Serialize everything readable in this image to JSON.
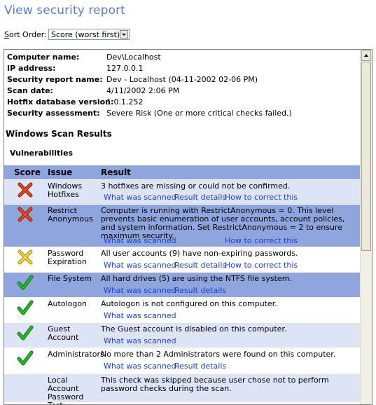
{
  "page": {
    "title": "View security report",
    "sort_label_access": "S",
    "sort_label_rest": "ort Order:",
    "sort_value": "Score (worst first)"
  },
  "info": [
    {
      "key": "Computer name:",
      "value": "Dev\\Localhost"
    },
    {
      "key": "IP address:",
      "value": "127.0.0.1"
    },
    {
      "key": "Security report name:",
      "value": "Dev - Localhost (04-11-2002 02-06 PM)"
    },
    {
      "key": "Scan date:",
      "value": "4/11/2002 2:06 PM"
    },
    {
      "key": "Hotfix database version:",
      "value": "1.0.1.252"
    },
    {
      "key": "Security assessment:",
      "value": "Severe Risk (One or more critical checks failed.)"
    }
  ],
  "section_title": "Windows Scan Results",
  "subsection_title": "Vulnerabilities",
  "table": {
    "headers": {
      "score": "Score",
      "issue": "Issue",
      "result": "Result"
    },
    "link_labels": {
      "scanned": "What was scanned",
      "details": "Result details",
      "correct": "How to correct this"
    },
    "rows": [
      {
        "score": "red-x",
        "issue": "Windows Hotfixes",
        "result": "3 hotfixes are missing or could not be confirmed."
      },
      {
        "score": "red-x",
        "issue": "Restrict Anonymous",
        "result": "Computer is running with RestrictAnonymous = 0. This level prevents basic enumeration of user accounts, account policies, and system information. Set RestrictAnonymous = 2 to ensure maximum security."
      },
      {
        "score": "yellow-x",
        "issue": "Password Expiration",
        "result": "All user accounts (9) have non-expiring passwords."
      },
      {
        "score": "green-check",
        "issue": "File System",
        "result": "All hard drives (5) are using the NTFS file system."
      },
      {
        "score": "green-check",
        "issue": "Autologon",
        "result": "Autologon is not configured on this computer."
      },
      {
        "score": "green-check",
        "issue": "Guest Account",
        "result": "The Guest account is disabled on this computer."
      },
      {
        "score": "green-check",
        "issue": "Administrators",
        "result": "No more than 2 Administrators were found on this computer."
      },
      {
        "score": "none",
        "issue": "Local Account Password Test",
        "result": "This check was skipped because user chose not to perform password checks during the scan."
      }
    ]
  },
  "colors": {
    "title": "#5a7fc8",
    "header_bg": "#8ea6dd",
    "row_light": "#dce4f5",
    "link": "#1f3fd2",
    "red_x": "#d83a1c",
    "yellow_x": "#e3c43a",
    "green_check": "#1aa51a"
  }
}
